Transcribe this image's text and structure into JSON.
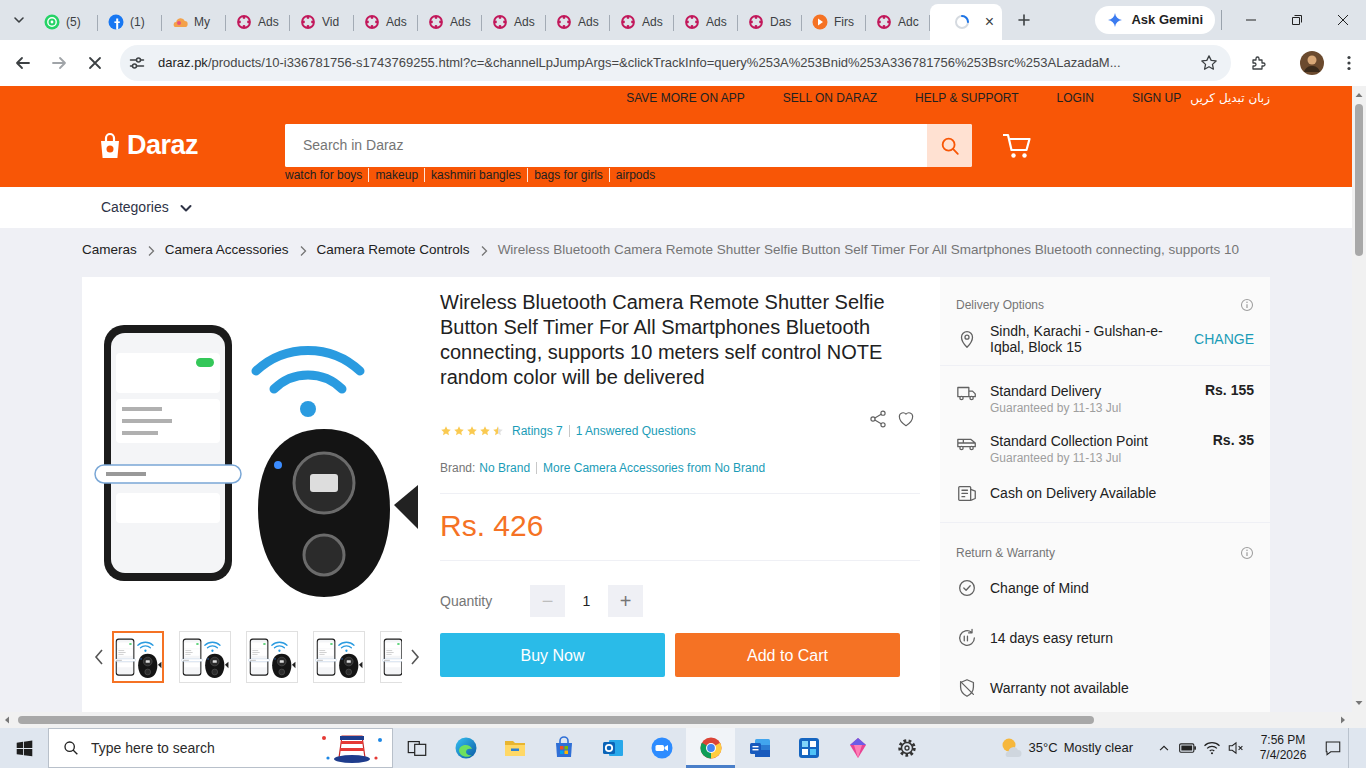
{
  "browser": {
    "tabs": [
      {
        "label": "(5)",
        "kind": "whatsapp",
        "selected": false
      },
      {
        "label": "(1)",
        "kind": "facebook",
        "selected": false
      },
      {
        "label": "My",
        "kind": "cloud",
        "selected": false
      },
      {
        "label": "Ads",
        "kind": "ads",
        "selected": false
      },
      {
        "label": "Vid",
        "kind": "ads",
        "selected": false
      },
      {
        "label": "Ads",
        "kind": "ads",
        "selected": false
      },
      {
        "label": "Ads",
        "kind": "ads",
        "selected": false
      },
      {
        "label": "Ads",
        "kind": "ads",
        "selected": false
      },
      {
        "label": "Ads",
        "kind": "ads",
        "selected": false
      },
      {
        "label": "Ads",
        "kind": "ads",
        "selected": false
      },
      {
        "label": "Ads",
        "kind": "ads",
        "selected": false
      },
      {
        "label": "Das",
        "kind": "ads",
        "selected": false
      },
      {
        "label": "Firs",
        "kind": "orange",
        "selected": false
      },
      {
        "label": "Adc",
        "kind": "ads",
        "selected": false
      },
      {
        "kind": "loading",
        "close": "×",
        "selected": true
      }
    ],
    "gemini_button": "Ask Gemini",
    "address": {
      "host": "daraz.pk",
      "path": "/products/10-i336781756-s1743769255.html?c=&channelLpJumpArgs=&clickTrackInfo=query%253A%253Bnid%253A336781756%253Bsrc%253ALazadaM..."
    }
  },
  "site": {
    "top_links": [
      "SAVE MORE ON APP",
      "SELL ON DARAZ",
      "HELP & SUPPORT",
      "LOGIN",
      "SIGN UP",
      "زبان تبدیل کریں"
    ],
    "logo": "Daraz",
    "search": {
      "placeholder": "Search in Daraz"
    },
    "suggestions": [
      "watch for boys",
      "makeup",
      "kashmiri bangles",
      "bags for girls",
      "airpods"
    ],
    "categories": "Categories"
  },
  "breadcrumb": [
    "Cameras",
    "Camera Accessories",
    "Camera Remote Controls",
    "Wireless Bluetooth Camera Remote Shutter Selfie Button Self Timer For All Smartphones Bluetooth connecting, supports 10"
  ],
  "product": {
    "thumbnails": [
      {
        "selected": true
      },
      {
        "selected": false
      },
      {
        "selected": false
      },
      {
        "selected": false
      },
      {
        "selected": false
      }
    ],
    "title": "Wireless Bluetooth Camera Remote Shutter Selfie Button Self Timer For All Smartphones Bluetooth connecting, supports 10 meters self control NOTE random color will be delivered",
    "rating": {
      "stars": 4.5,
      "ratings": "Ratings 7",
      "questions": "1 Answered Questions"
    },
    "brand": {
      "label": "Brand:",
      "name": "No Brand",
      "more": "More Camera Accessories from No Brand"
    },
    "price": "Rs. 426",
    "quantity": {
      "label": "Quantity",
      "value": "1",
      "minus": {
        "label": "−",
        "disabled": true
      },
      "plus": {
        "label": "+",
        "disabled": false
      }
    },
    "buttons": {
      "buy": "Buy Now",
      "cart": "Add to Cart"
    }
  },
  "delivery": {
    "title": "Delivery Options",
    "location": "Sindh, Karachi - Gulshan-e-Iqbal, Block 15",
    "change": "CHANGE",
    "options": [
      {
        "kind": "standard",
        "name": "Standard Delivery",
        "note": "Guaranteed by 11-13 Jul",
        "price": "Rs. 155"
      },
      {
        "kind": "collection",
        "name": "Standard Collection Point",
        "note": "Guaranteed by 11-13 Jul",
        "price": "Rs. 35"
      },
      {
        "kind": "cod",
        "name": "Cash on Delivery Available"
      }
    ],
    "return_title": "Return & Warranty",
    "return_items": [
      {
        "kind": "change",
        "label": "Change of Mind"
      },
      {
        "kind": "return",
        "label": "14 days easy return"
      },
      {
        "kind": "warranty",
        "label": "Warranty not available"
      }
    ]
  },
  "taskbar": {
    "search_placeholder": "Type here to search",
    "apps": [
      {
        "kind": "edge",
        "active": false
      },
      {
        "kind": "explorer",
        "active": false
      },
      {
        "kind": "store",
        "active": false
      },
      {
        "kind": "outlook",
        "active": false
      },
      {
        "kind": "zoom",
        "active": false
      },
      {
        "kind": "chrome",
        "active": true
      },
      {
        "kind": "word",
        "active": false
      },
      {
        "kind": "tiles",
        "active": false
      },
      {
        "kind": "gem",
        "active": false
      },
      {
        "kind": "settings",
        "active": false
      }
    ],
    "weather": {
      "temperature": "35°C",
      "condition": "Mostly clear"
    },
    "clock": {
      "time": "7:56 PM",
      "date": "7/4/2026"
    }
  }
}
